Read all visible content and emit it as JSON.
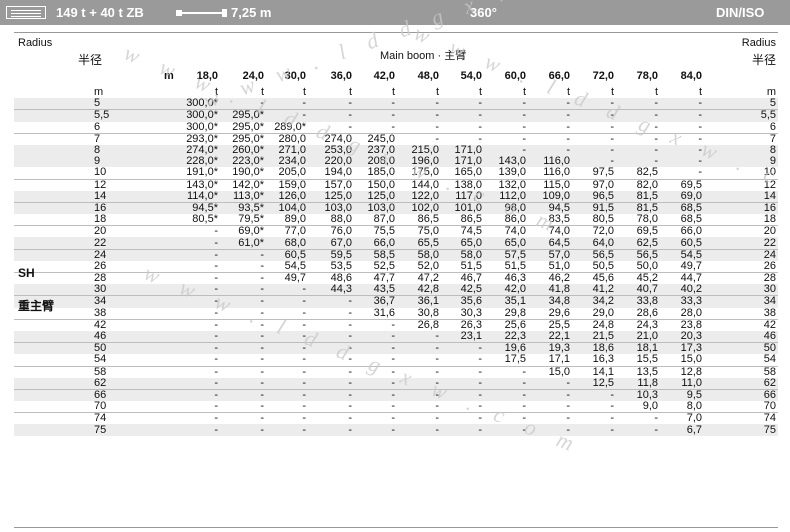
{
  "topbar": {
    "config": "149 t + 40 t ZB",
    "boom_length": "7,25 m",
    "rotation": "360°",
    "standard": "DIN/ISO"
  },
  "header": {
    "radius_en": "Radius",
    "radius_cn": "半径",
    "boom_title": "Main boom · 主臂",
    "unit_m": "m"
  },
  "side_labels": {
    "sh": "SH",
    "cn": "重主臂"
  },
  "watermark": "w w w . l d d g x w . c o m",
  "table": {
    "boom_lengths": [
      "18,0",
      "24,0",
      "30,0",
      "36,0",
      "42,0",
      "48,0",
      "54,0",
      "60,0",
      "66,0",
      "72,0",
      "78,0",
      "84,0"
    ],
    "rows": [
      [
        "m",
        "t",
        "t",
        "t",
        "t",
        "t",
        "t",
        "t",
        "t",
        "t",
        "t",
        "t",
        "t",
        "m"
      ],
      [
        "5",
        "300,0*",
        "-",
        "-",
        "-",
        "-",
        "-",
        "-",
        "-",
        "-",
        "-",
        "-",
        "-",
        "5"
      ],
      [
        "5,5",
        "300,0*",
        "295,0*",
        "-",
        "-",
        "-",
        "-",
        "-",
        "-",
        "-",
        "-",
        "-",
        "-",
        "5,5"
      ],
      [
        "6",
        "300,0*",
        "295,0*",
        "289,0*",
        "-",
        "-",
        "-",
        "-",
        "-",
        "-",
        "-",
        "-",
        "-",
        "6"
      ],
      [
        "7",
        "293,0*",
        "295,0*",
        "280,0",
        "274,0",
        "245,0",
        "-",
        "-",
        "-",
        "-",
        "-",
        "-",
        "-",
        "7"
      ],
      [
        "8",
        "274,0*",
        "260,0*",
        "271,0",
        "253,0",
        "237,0",
        "215,0",
        "171,0",
        "-",
        "-",
        "-",
        "-",
        "-",
        "8"
      ],
      [
        "9",
        "228,0*",
        "223,0*",
        "234,0",
        "220,0",
        "208,0",
        "196,0",
        "171,0",
        "143,0",
        "116,0",
        "-",
        "-",
        "-",
        "9"
      ],
      [
        "10",
        "191,0*",
        "190,0*",
        "205,0",
        "194,0",
        "185,0",
        "175,0",
        "165,0",
        "139,0",
        "116,0",
        "97,5",
        "82,5",
        "-",
        "10"
      ],
      [
        "12",
        "143,0*",
        "142,0*",
        "159,0",
        "157,0",
        "150,0",
        "144,0",
        "138,0",
        "132,0",
        "115,0",
        "97,0",
        "82,0",
        "69,5",
        "12"
      ],
      [
        "14",
        "114,0*",
        "113,0*",
        "126,0",
        "125,0",
        "125,0",
        "122,0",
        "117,0",
        "112,0",
        "109,0",
        "96,5",
        "81,5",
        "69,0",
        "14"
      ],
      [
        "16",
        "94,5*",
        "93,5*",
        "104,0",
        "103,0",
        "103,0",
        "102,0",
        "101,0",
        "98,0",
        "94,5",
        "91,5",
        "81,5",
        "68,5",
        "16"
      ],
      [
        "18",
        "80,5*",
        "79,5*",
        "89,0",
        "88,0",
        "87,0",
        "86,5",
        "86,5",
        "86,0",
        "83,5",
        "80,5",
        "78,0",
        "68,5",
        "18"
      ],
      [
        "20",
        "-",
        "69,0*",
        "77,0",
        "76,0",
        "75,5",
        "75,0",
        "74,5",
        "74,0",
        "74,0",
        "72,0",
        "69,5",
        "66,0",
        "20"
      ],
      [
        "22",
        "-",
        "61,0*",
        "68,0",
        "67,0",
        "66,0",
        "65,5",
        "65,0",
        "65,0",
        "64,5",
        "64,0",
        "62,5",
        "60,5",
        "22"
      ],
      [
        "24",
        "-",
        "-",
        "60,5",
        "59,5",
        "58,5",
        "58,0",
        "58,0",
        "57,5",
        "57,0",
        "56,5",
        "56,5",
        "54,5",
        "24"
      ],
      [
        "26",
        "-",
        "-",
        "54,5",
        "53,5",
        "52,5",
        "52,0",
        "51,5",
        "51,5",
        "51,0",
        "50,5",
        "50,0",
        "49,7",
        "26"
      ],
      [
        "28",
        "-",
        "-",
        "49,7",
        "48,6",
        "47,7",
        "47,2",
        "46,7",
        "46,3",
        "46,2",
        "45,6",
        "45,2",
        "44,7",
        "28"
      ],
      [
        "30",
        "-",
        "-",
        "-",
        "44,3",
        "43,5",
        "42,8",
        "42,5",
        "42,0",
        "41,8",
        "41,2",
        "40,7",
        "40,2",
        "30"
      ],
      [
        "34",
        "-",
        "-",
        "-",
        "-",
        "36,7",
        "36,1",
        "35,6",
        "35,1",
        "34,8",
        "34,2",
        "33,8",
        "33,3",
        "34"
      ],
      [
        "38",
        "-",
        "-",
        "-",
        "-",
        "31,6",
        "30,8",
        "30,3",
        "29,8",
        "29,6",
        "29,0",
        "28,6",
        "28,0",
        "38"
      ],
      [
        "42",
        "-",
        "-",
        "-",
        "-",
        "-",
        "26,8",
        "26,3",
        "25,6",
        "25,5",
        "24,8",
        "24,3",
        "23,8",
        "42"
      ],
      [
        "46",
        "-",
        "-",
        "-",
        "-",
        "-",
        "-",
        "23,1",
        "22,3",
        "22,1",
        "21,5",
        "21,0",
        "20,3",
        "46"
      ],
      [
        "50",
        "-",
        "-",
        "-",
        "-",
        "-",
        "-",
        "-",
        "19,6",
        "19,3",
        "18,6",
        "18,1",
        "17,3",
        "50"
      ],
      [
        "54",
        "-",
        "-",
        "-",
        "-",
        "-",
        "-",
        "-",
        "17,5",
        "17,1",
        "16,3",
        "15,5",
        "15,0",
        "54"
      ],
      [
        "58",
        "-",
        "-",
        "-",
        "-",
        "-",
        "-",
        "-",
        "-",
        "15,0",
        "14,1",
        "13,5",
        "12,8",
        "58"
      ],
      [
        "62",
        "-",
        "-",
        "-",
        "-",
        "-",
        "-",
        "-",
        "-",
        "-",
        "12,5",
        "11,8",
        "11,0",
        "62"
      ],
      [
        "66",
        "-",
        "-",
        "-",
        "-",
        "-",
        "-",
        "-",
        "-",
        "-",
        "-",
        "10,3",
        "9,5",
        "66"
      ],
      [
        "70",
        "-",
        "-",
        "-",
        "-",
        "-",
        "-",
        "-",
        "-",
        "-",
        "-",
        "9,0",
        "8,0",
        "70"
      ],
      [
        "74",
        "-",
        "-",
        "-",
        "-",
        "-",
        "-",
        "-",
        "-",
        "-",
        "-",
        "-",
        "7,0",
        "74"
      ],
      [
        "75",
        "-",
        "-",
        "-",
        "-",
        "-",
        "-",
        "-",
        "-",
        "-",
        "-",
        "-",
        "6,7",
        "75"
      ]
    ]
  }
}
